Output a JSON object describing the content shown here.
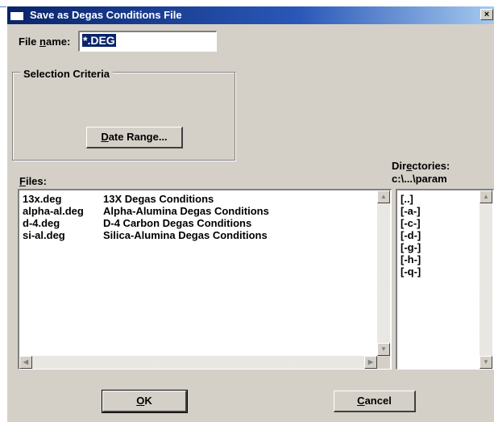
{
  "window": {
    "title": "Save as Degas Conditions File",
    "close_glyph": "×"
  },
  "filename": {
    "label_pre": "File ",
    "label_mnemonic": "n",
    "label_post": "ame:",
    "value": "*.DEG"
  },
  "selection": {
    "title": "Selection Criteria",
    "date_range_mnemonic": "D",
    "date_range_rest": "ate Range..."
  },
  "files": {
    "label_mnemonic": "F",
    "label_rest": "iles:",
    "items": [
      {
        "name": "13x.deg",
        "desc": "13X Degas Conditions"
      },
      {
        "name": "alpha-al.deg",
        "desc": "Alpha-Alumina Degas Conditions"
      },
      {
        "name": "d-4.deg",
        "desc": "D-4 Carbon Degas Conditions"
      },
      {
        "name": "si-al.deg",
        "desc": "Silica-Alumina Degas Conditions"
      }
    ]
  },
  "directories": {
    "label_pre": "Dir",
    "label_mnemonic": "e",
    "label_post": "ctories:",
    "path": "c:\\...\\param",
    "items": [
      "[..]",
      "[-a-]",
      "[-c-]",
      "[-d-]",
      "[-g-]",
      "[-h-]",
      "[-q-]"
    ]
  },
  "buttons": {
    "ok_mnemonic": "O",
    "ok_rest": "K",
    "cancel_mnemonic": "C",
    "cancel_rest": "ancel"
  },
  "icons": {
    "scroll_up": "▲",
    "scroll_down": "▼",
    "scroll_left": "◀",
    "scroll_right": "▶"
  }
}
